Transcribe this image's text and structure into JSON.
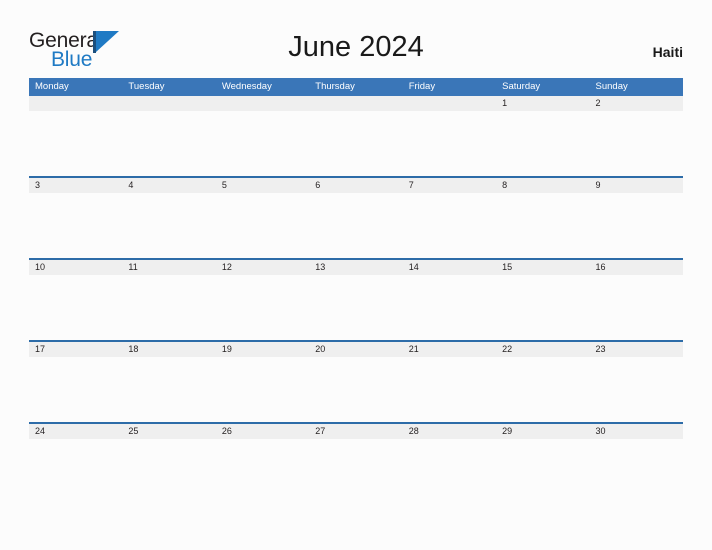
{
  "brand": {
    "name_part1": "General",
    "name_part2": "Blue",
    "flag_icon": "flag-triangle-icon",
    "accent_color": "#1f7ac4"
  },
  "header": {
    "title": "June 2024",
    "country": "Haiti"
  },
  "calendar": {
    "month": "June",
    "year": "2024",
    "header_bg_color": "#3a76b8",
    "row_band_color": "#efefef",
    "row_border_color": "#2d6ca8",
    "weekdays": [
      "Monday",
      "Tuesday",
      "Wednesday",
      "Thursday",
      "Friday",
      "Saturday",
      "Sunday"
    ],
    "weeks": [
      [
        "",
        "",
        "",
        "",
        "",
        "1",
        "2"
      ],
      [
        "3",
        "4",
        "5",
        "6",
        "7",
        "8",
        "9"
      ],
      [
        "10",
        "11",
        "12",
        "13",
        "14",
        "15",
        "16"
      ],
      [
        "17",
        "18",
        "19",
        "20",
        "21",
        "22",
        "23"
      ],
      [
        "24",
        "25",
        "26",
        "27",
        "28",
        "29",
        "30"
      ]
    ]
  }
}
